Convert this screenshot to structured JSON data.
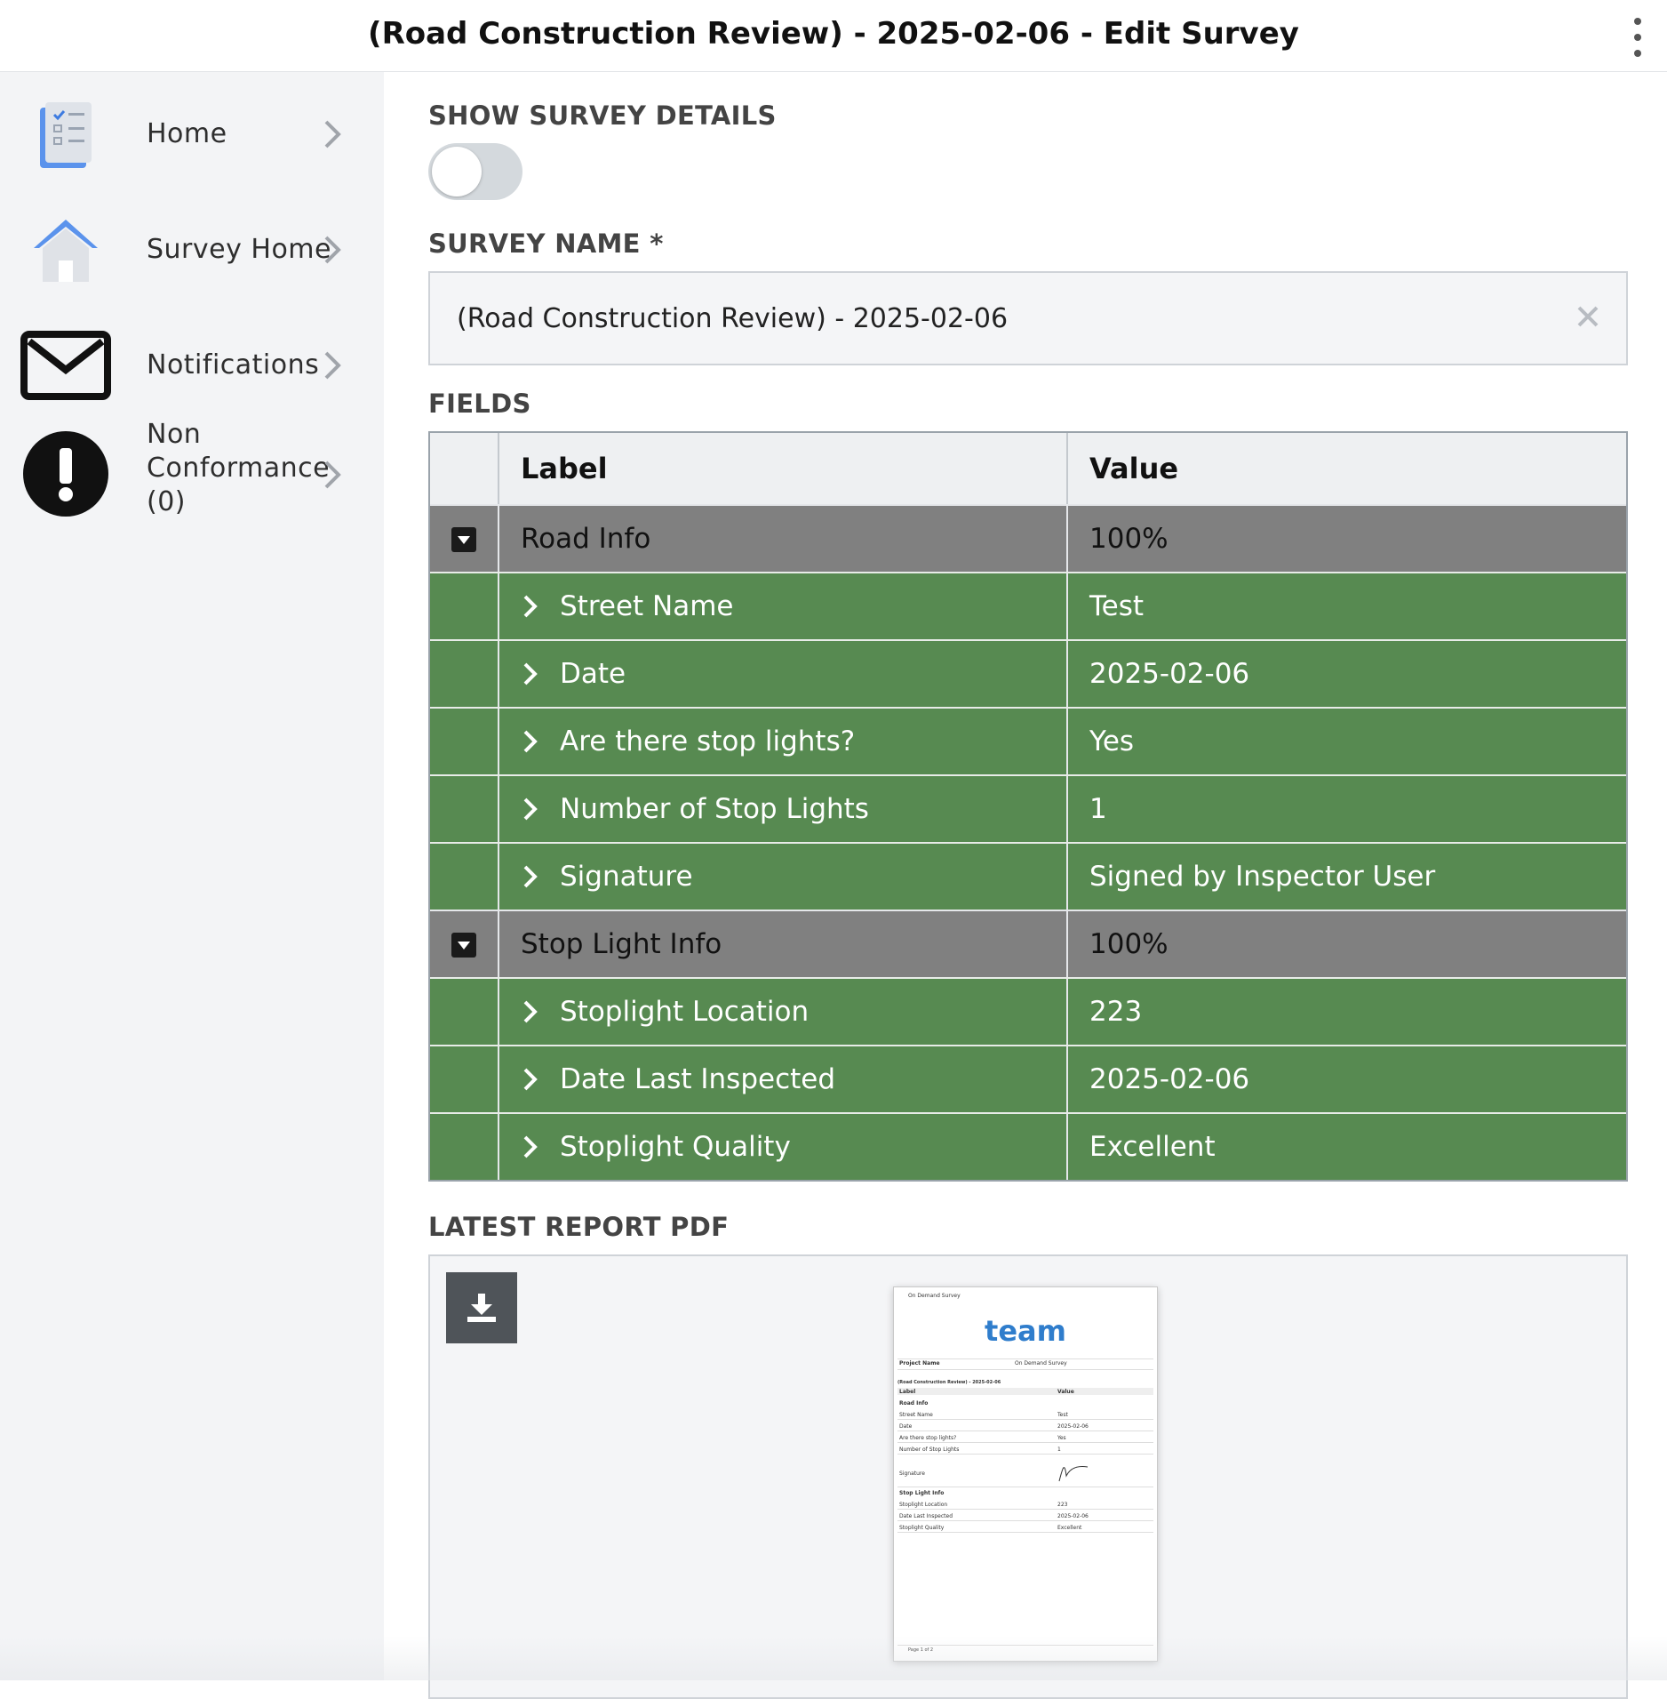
{
  "header": {
    "title": "(Road Construction Review) - 2025-02-06 - Edit Survey",
    "menu_icon": "more-vertical-icon"
  },
  "sidebar": {
    "items": [
      {
        "label": "Home",
        "icon": "checklist-icon"
      },
      {
        "label": "Survey Home",
        "icon": "house-icon"
      },
      {
        "label": "Notifications",
        "icon": "envelope-icon"
      },
      {
        "label_lines": [
          "Non",
          "Conformance",
          "(0)"
        ],
        "icon": "exclamation-circle-icon"
      }
    ]
  },
  "main": {
    "show_details_label": "SHOW SURVEY DETAILS",
    "show_details_on": false,
    "survey_name_label": "SURVEY NAME *",
    "survey_name_value": "(Road Construction Review) - 2025-02-06",
    "fields_label": "FIELDS",
    "table": {
      "headers": [
        "Label",
        "Value"
      ],
      "rows": [
        {
          "type": "group",
          "label": "Road Info",
          "value": "100%"
        },
        {
          "type": "field",
          "label": "Street Name",
          "value": "Test"
        },
        {
          "type": "field",
          "label": "Date",
          "value": "2025-02-06"
        },
        {
          "type": "field",
          "label": "Are there stop lights?",
          "value": "Yes"
        },
        {
          "type": "field",
          "label": "Number of Stop Lights",
          "value": "1"
        },
        {
          "type": "field",
          "label": "Signature",
          "value": "Signed by Inspector User"
        },
        {
          "type": "group",
          "label": "Stop Light Info",
          "value": "100%"
        },
        {
          "type": "field",
          "label": "Stoplight Location",
          "value": "223"
        },
        {
          "type": "field",
          "label": "Date Last Inspected",
          "value": "2025-02-06"
        },
        {
          "type": "field",
          "label": "Stoplight Quality",
          "value": "Excellent"
        }
      ]
    },
    "latest_report_label": "LATEST REPORT PDF",
    "download_icon": "download-icon",
    "pdf_preview": {
      "header_text": "On Demand Survey",
      "brand": "team",
      "project_name_label": "Project Name",
      "project_name_value": "On Demand Survey",
      "survey_title": "(Road Construction Review) - 2025-02-06",
      "col_label": "Label",
      "col_value": "Value",
      "group1": "Road Info",
      "rows1": [
        [
          "Street Name",
          "Test"
        ],
        [
          "Date",
          "2025-02-06"
        ],
        [
          "Are there stop lights?",
          "Yes"
        ],
        [
          "Number of Stop Lights",
          "1"
        ],
        [
          "Signature",
          ""
        ]
      ],
      "group2": "Stop Light Info",
      "rows2": [
        [
          "Stoplight Location",
          "223"
        ],
        [
          "Date Last Inspected",
          "2025-02-06"
        ],
        [
          "Stoplight Quality",
          "Excellent"
        ]
      ],
      "footer": "Page 1 of 2"
    }
  },
  "colors": {
    "group_row": "#808080",
    "field_row": "#578a51",
    "brand_blue": "#2f7dcc"
  }
}
